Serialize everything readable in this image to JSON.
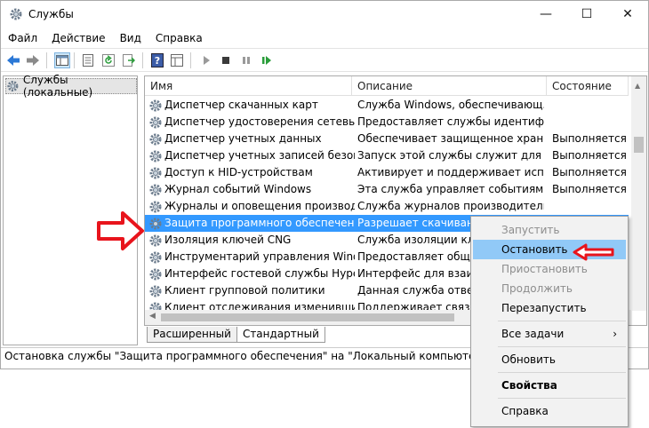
{
  "window": {
    "title": "Службы",
    "controls": {
      "minimize": "—",
      "maximize": "☐",
      "close": "✕"
    }
  },
  "menubar": [
    "Файл",
    "Действие",
    "Вид",
    "Справка"
  ],
  "toolbar": {
    "icons": [
      "back-arrow-icon",
      "forward-arrow-icon",
      "console-tree-icon",
      "properties-icon",
      "refresh-icon",
      "export-icon",
      "help-icon",
      "view-icon",
      "start-service-icon",
      "stop-service-icon",
      "pause-service-icon",
      "restart-service-icon"
    ]
  },
  "tree": {
    "root_label": "Службы (локальные)"
  },
  "table": {
    "columns": [
      "Имя",
      "Описание",
      "Состояние"
    ],
    "rows": [
      {
        "name": "Диспетчер скачанных карт",
        "desc": "Служба Windows, обеспечивающ...",
        "status": ""
      },
      {
        "name": "Диспетчер удостоверения сетевых у...",
        "desc": "Предоставляет службы идентифика...",
        "status": ""
      },
      {
        "name": "Диспетчер учетных данных",
        "desc": "Обеспечивает защищенное хранен...",
        "status": "Выполняется"
      },
      {
        "name": "Диспетчер учетных записей безопа...",
        "desc": "Запуск этой службы служит для др...",
        "status": "Выполняется"
      },
      {
        "name": "Доступ к HID-устройствам",
        "desc": "Активирует и поддерживает исполь...",
        "status": "Выполняется"
      },
      {
        "name": "Журнал событий Windows",
        "desc": "Эта служба управляет событиями и...",
        "status": "Выполняется"
      },
      {
        "name": "Журналы и оповещения производи...",
        "desc": "Служба журналов производительн...",
        "status": ""
      },
      {
        "name": "Защита программного обеспечения",
        "desc": "Разрешает скачивание,",
        "status": ""
      },
      {
        "name": "Изоляция ключей CNG",
        "desc": "Служба изоляции ключе",
        "status": ""
      },
      {
        "name": "Инструментарий управления Wind...",
        "desc": "Предоставляет общий",
        "status": ""
      },
      {
        "name": "Интерфейс гостевой службы Hyper-V",
        "desc": "Интерфейс для взаимод",
        "status": ""
      },
      {
        "name": "Клиент групповой политики",
        "desc": "Данная служба отвечае",
        "status": ""
      },
      {
        "name": "Клиент отслеживания изменивших...",
        "desc": "Поддерживает связи NT",
        "status": ""
      }
    ],
    "selected_index": 7
  },
  "tabs": [
    "Расширенный",
    "Стандартный"
  ],
  "statusbar": "Остановка службы \"Защита программного обеспечения\" на \"Локальный компьютер\"",
  "context_menu": {
    "items": [
      {
        "label": "Запустить",
        "state": "disabled"
      },
      {
        "label": "Остановить",
        "state": "hover"
      },
      {
        "label": "Приостановить",
        "state": "disabled"
      },
      {
        "label": "Продолжить",
        "state": "disabled"
      },
      {
        "label": "Перезапустить",
        "state": "enabled"
      },
      {
        "label": "Все задачи",
        "state": "submenu",
        "arrow": "›"
      },
      {
        "label": "Обновить",
        "state": "enabled"
      },
      {
        "label": "Свойства",
        "state": "bold"
      },
      {
        "label": "Справка",
        "state": "enabled"
      }
    ]
  },
  "colors": {
    "selection": "#3399ff",
    "menu_hover": "#91c9f7",
    "annotation_arrow": "#e8141c"
  }
}
